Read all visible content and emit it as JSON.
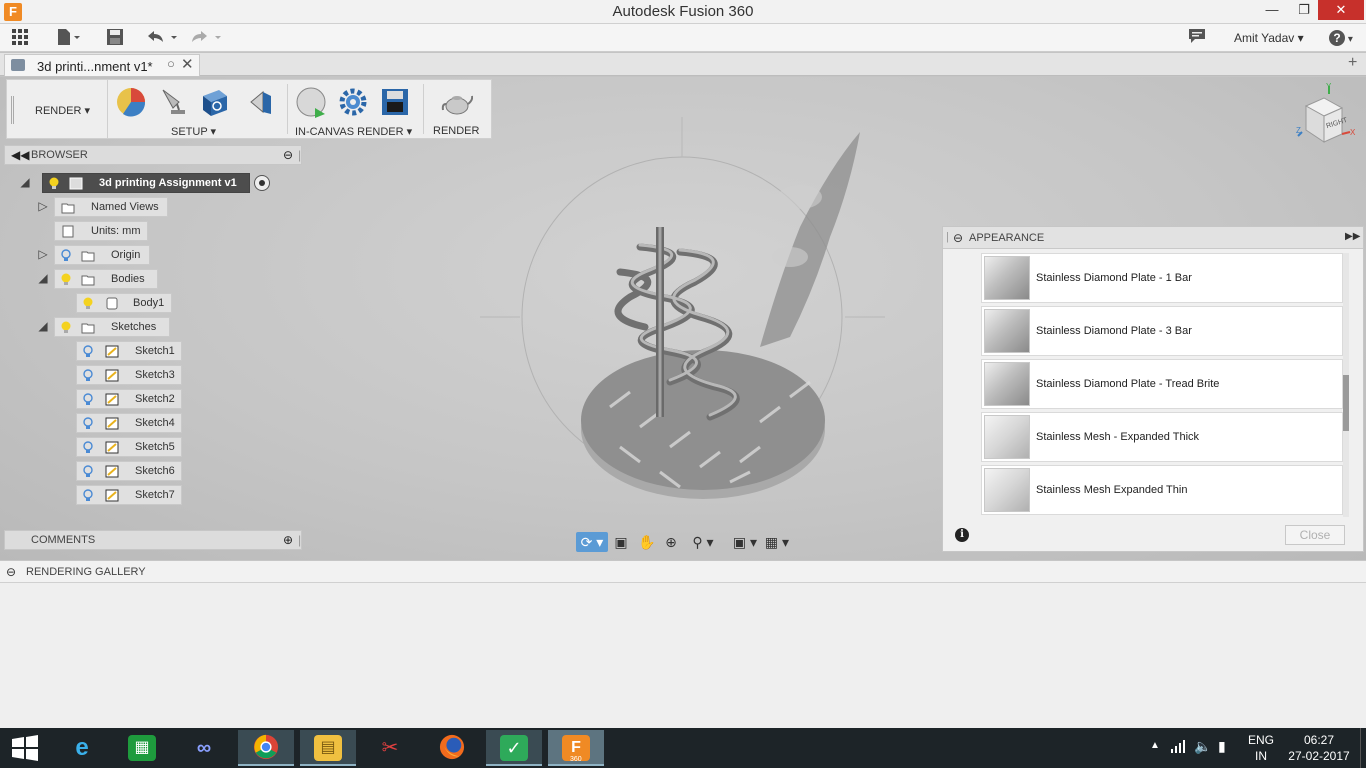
{
  "window": {
    "title": "Autodesk Fusion 360",
    "logo_letter": "F"
  },
  "qat": {
    "user_name": "Amit Yadav",
    "help_glyph": "?"
  },
  "document_tab": {
    "name": "3d printi...nment v1*"
  },
  "ribbon": {
    "workspace": "RENDER ▾",
    "setup_label": "SETUP ▾",
    "in_canvas_label": "IN-CANVAS RENDER ▾",
    "render_label": "RENDER"
  },
  "viewcube": {
    "face_label": "RIGHT",
    "axis_x": "X",
    "axis_y": "Y",
    "axis_z": "Z"
  },
  "browser": {
    "title": "BROWSER",
    "root": "3d printing Assignment v1",
    "named_views": "Named Views",
    "units": "Units: mm",
    "origin": "Origin",
    "bodies": "Bodies",
    "body1": "Body1",
    "sketches": "Sketches",
    "sketch_items": [
      "Sketch1",
      "Sketch3",
      "Sketch2",
      "Sketch4",
      "Sketch5",
      "Sketch6",
      "Sketch7"
    ]
  },
  "comments": {
    "title": "COMMENTS"
  },
  "appearance": {
    "title": "APPEARANCE",
    "materials": [
      "Stainless Diamond Plate - 1 Bar",
      "Stainless Diamond Plate - 3 Bar",
      "Stainless Diamond Plate - Tread Brite",
      "Stainless Mesh - Expanded Thick",
      "Stainless Mesh Expanded Thin"
    ],
    "close_label": "Close",
    "info_glyph": "i"
  },
  "gallery": {
    "title": "RENDERING GALLERY"
  },
  "taskbar": {
    "language": "ENG",
    "region": "IN",
    "time": "06:27",
    "date": "27-02-2017",
    "fusion_badge": "360"
  },
  "colors": {
    "accent": "#5b9bd5",
    "close_red": "#c7302b",
    "fusion_orange": "#f08a24",
    "bulb_yellow": "#f4d21f"
  }
}
